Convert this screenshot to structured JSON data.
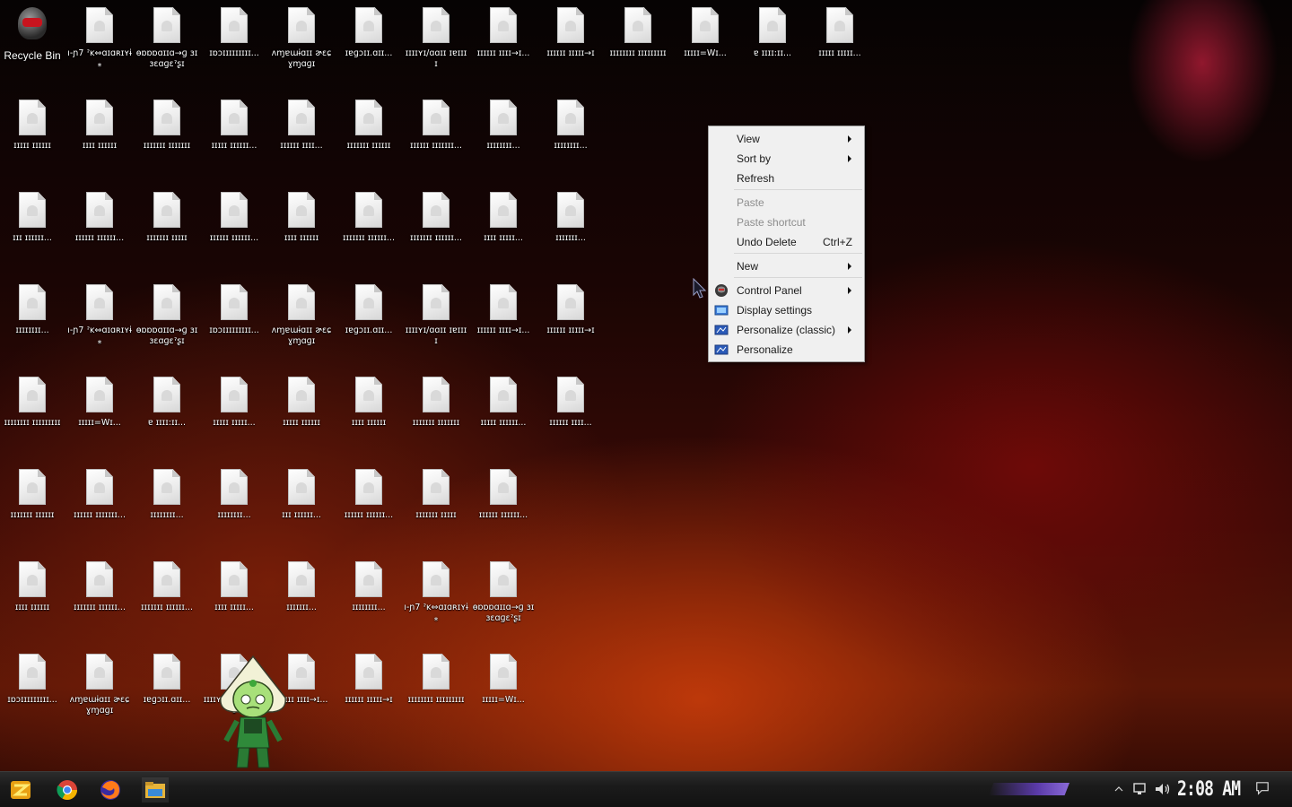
{
  "desktop": {
    "recycle_bin": "Recycle Bin",
    "icons": [
      "ı-ɲ7\nˀĸ⇔ɑɪɑʀɪʏɨ⁎",
      "ɵɒɒɒɑɪɪɑ→ɡ\nɜɪɜɛɑɡɛˀʂɪ",
      "ɪɒɔɪɪɪɪɪɪɪɪɪ...",
      "ʌɱɐɯɨɑɪɪ\nɚɛɕɣɱɑɡɪ",
      "ɪɐɡɔɪɪ.ɑɪɪ...",
      "ɪɪɪɪʏɪ/ɑɑɪɪ\nɪɐɪɪɪɪ",
      "ɪɪɪɪɪɪ\nɪɪɪɪ→ɪ...",
      "ɪɪɪɪɪɪ\nɪɪɪɪɪ→ɪ",
      "ɪɪɪɪɪɪɪɪ\nɪɪɪɪɪɪɪɪɪ",
      "ɪɪɪɪɪ=Wɪ...",
      "ɐ\nɪɪɪɪ:ɪɪ...",
      "ɪɪɪɪɪ\nɪɪɪɪɪ...",
      "ɪɪɪɪɪ\nɪɪɪɪɪɪ",
      "ɪɪɪɪ\nɪɪɪɪɪɪ",
      "ɪɪɪɪɪɪɪ\nɪɪɪɪɪɪɪ",
      "ɪɪɪɪɪ\nɪɪɪɪɪɪ...",
      "ɪɪɪɪɪɪ\nɪɪɪɪ...",
      "ɪɪɪɪɪɪɪ\nɪɪɪɪɪɪ",
      "ɪɪɪɪɪɪ\nɪɪɪɪɪɪɪ...",
      "ɪɪɪɪɪɪɪɪ...",
      "ɪɪɪɪɪɪɪɪ...",
      "ɪɪɪ\nɪɪɪɪɪɪ...",
      "ɪɪɪɪɪɪ\nɪɪɪɪɪɪ...",
      "ɪɪɪɪɪɪɪ\nɪɪɪɪɪ",
      "ɪɪɪɪɪɪ\nɪɪɪɪɪɪ...",
      "ɪɪɪɪ\nɪɪɪɪɪɪ",
      "ɪɪɪɪɪɪɪ\nɪɪɪɪɪɪ...",
      "ɪɪɪɪɪɪɪ\nɪɪɪɪɪɪ...",
      "ɪɪɪɪ\nɪɪɪɪɪ...",
      "ɪɪɪɪɪɪɪ...",
      "ɪɪɪɪɪɪɪɪ..."
    ]
  },
  "context_menu": {
    "items": [
      {
        "label": "View",
        "submenu": true
      },
      {
        "label": "Sort by",
        "submenu": true
      },
      {
        "label": "Refresh"
      },
      {
        "label": "Paste",
        "disabled": true
      },
      {
        "label": "Paste shortcut",
        "disabled": true
      },
      {
        "label": "Undo Delete",
        "shortcut": "Ctrl+Z"
      },
      {
        "label": "New",
        "submenu": true
      },
      {
        "label": "Control Panel",
        "submenu": true,
        "icon": "control-panel-icon"
      },
      {
        "label": "Display settings",
        "icon": "display-settings-icon"
      },
      {
        "label": "Personalize (classic)",
        "submenu": true,
        "icon": "personalize-classic-icon"
      },
      {
        "label": "Personalize",
        "icon": "personalize-icon"
      }
    ]
  },
  "taskbar": {
    "start_icon": "start-button-icon",
    "pinned": [
      "chrome-icon",
      "firefox-icon",
      "file-explorer-icon"
    ],
    "clock": "2:08 AM",
    "colors": {
      "accent": "#5a3aa8",
      "taskbar": "#1b1b1b"
    }
  }
}
